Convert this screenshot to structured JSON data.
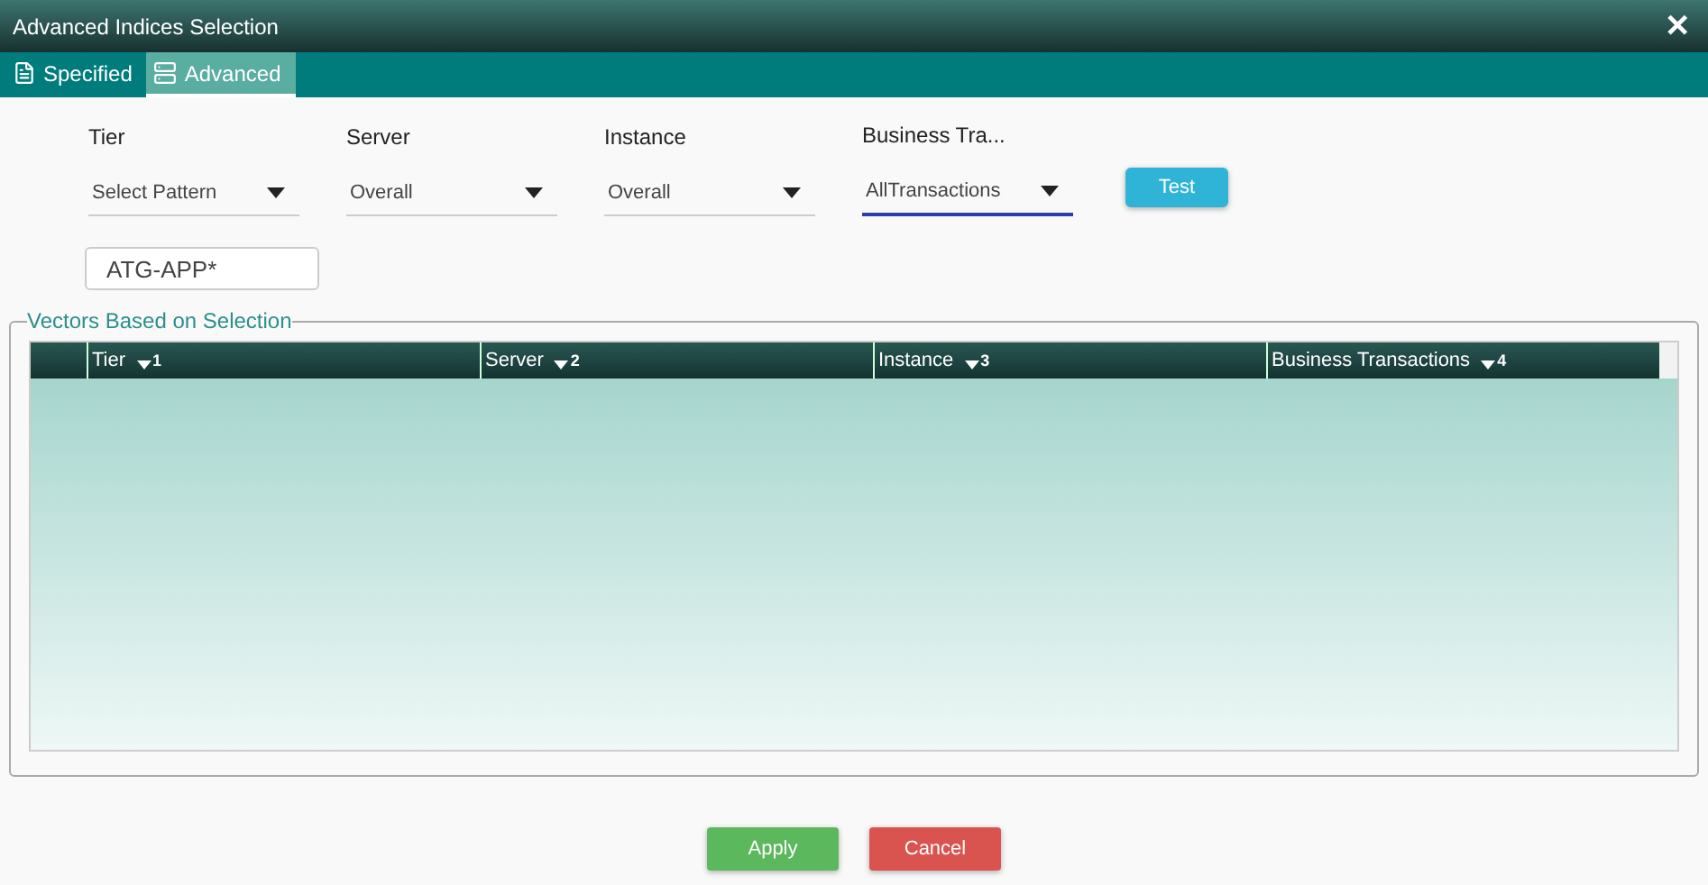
{
  "window": {
    "title": "Advanced Indices Selection",
    "close": "✕"
  },
  "tabs": [
    {
      "label": "Specified",
      "kind": "document",
      "selected": false
    },
    {
      "label": "Advanced",
      "kind": "server",
      "selected": true
    }
  ],
  "filters": [
    {
      "label": "Tier",
      "value": "Select Pattern",
      "focused": false
    },
    {
      "label": "Server",
      "value": "Overall",
      "focused": false
    },
    {
      "label": "Instance",
      "value": "Overall",
      "focused": false
    },
    {
      "label": "Business Tra...",
      "value": "AllTransactions",
      "focused": true
    }
  ],
  "test_button": "Test",
  "pattern_field": {
    "value": "ATG-APP*"
  },
  "vectors": {
    "legend": "Vectors Based on Selection",
    "columns": [
      {
        "label": "Tier",
        "sort_order": "1"
      },
      {
        "label": "Server",
        "sort_order": "2"
      },
      {
        "label": "Instance",
        "sort_order": "3"
      },
      {
        "label": "Business Transactions",
        "sort_order": "4"
      }
    ]
  },
  "buttons": [
    {
      "label": "Apply",
      "kind": "primary"
    },
    {
      "label": "Cancel",
      "kind": "danger"
    }
  ]
}
